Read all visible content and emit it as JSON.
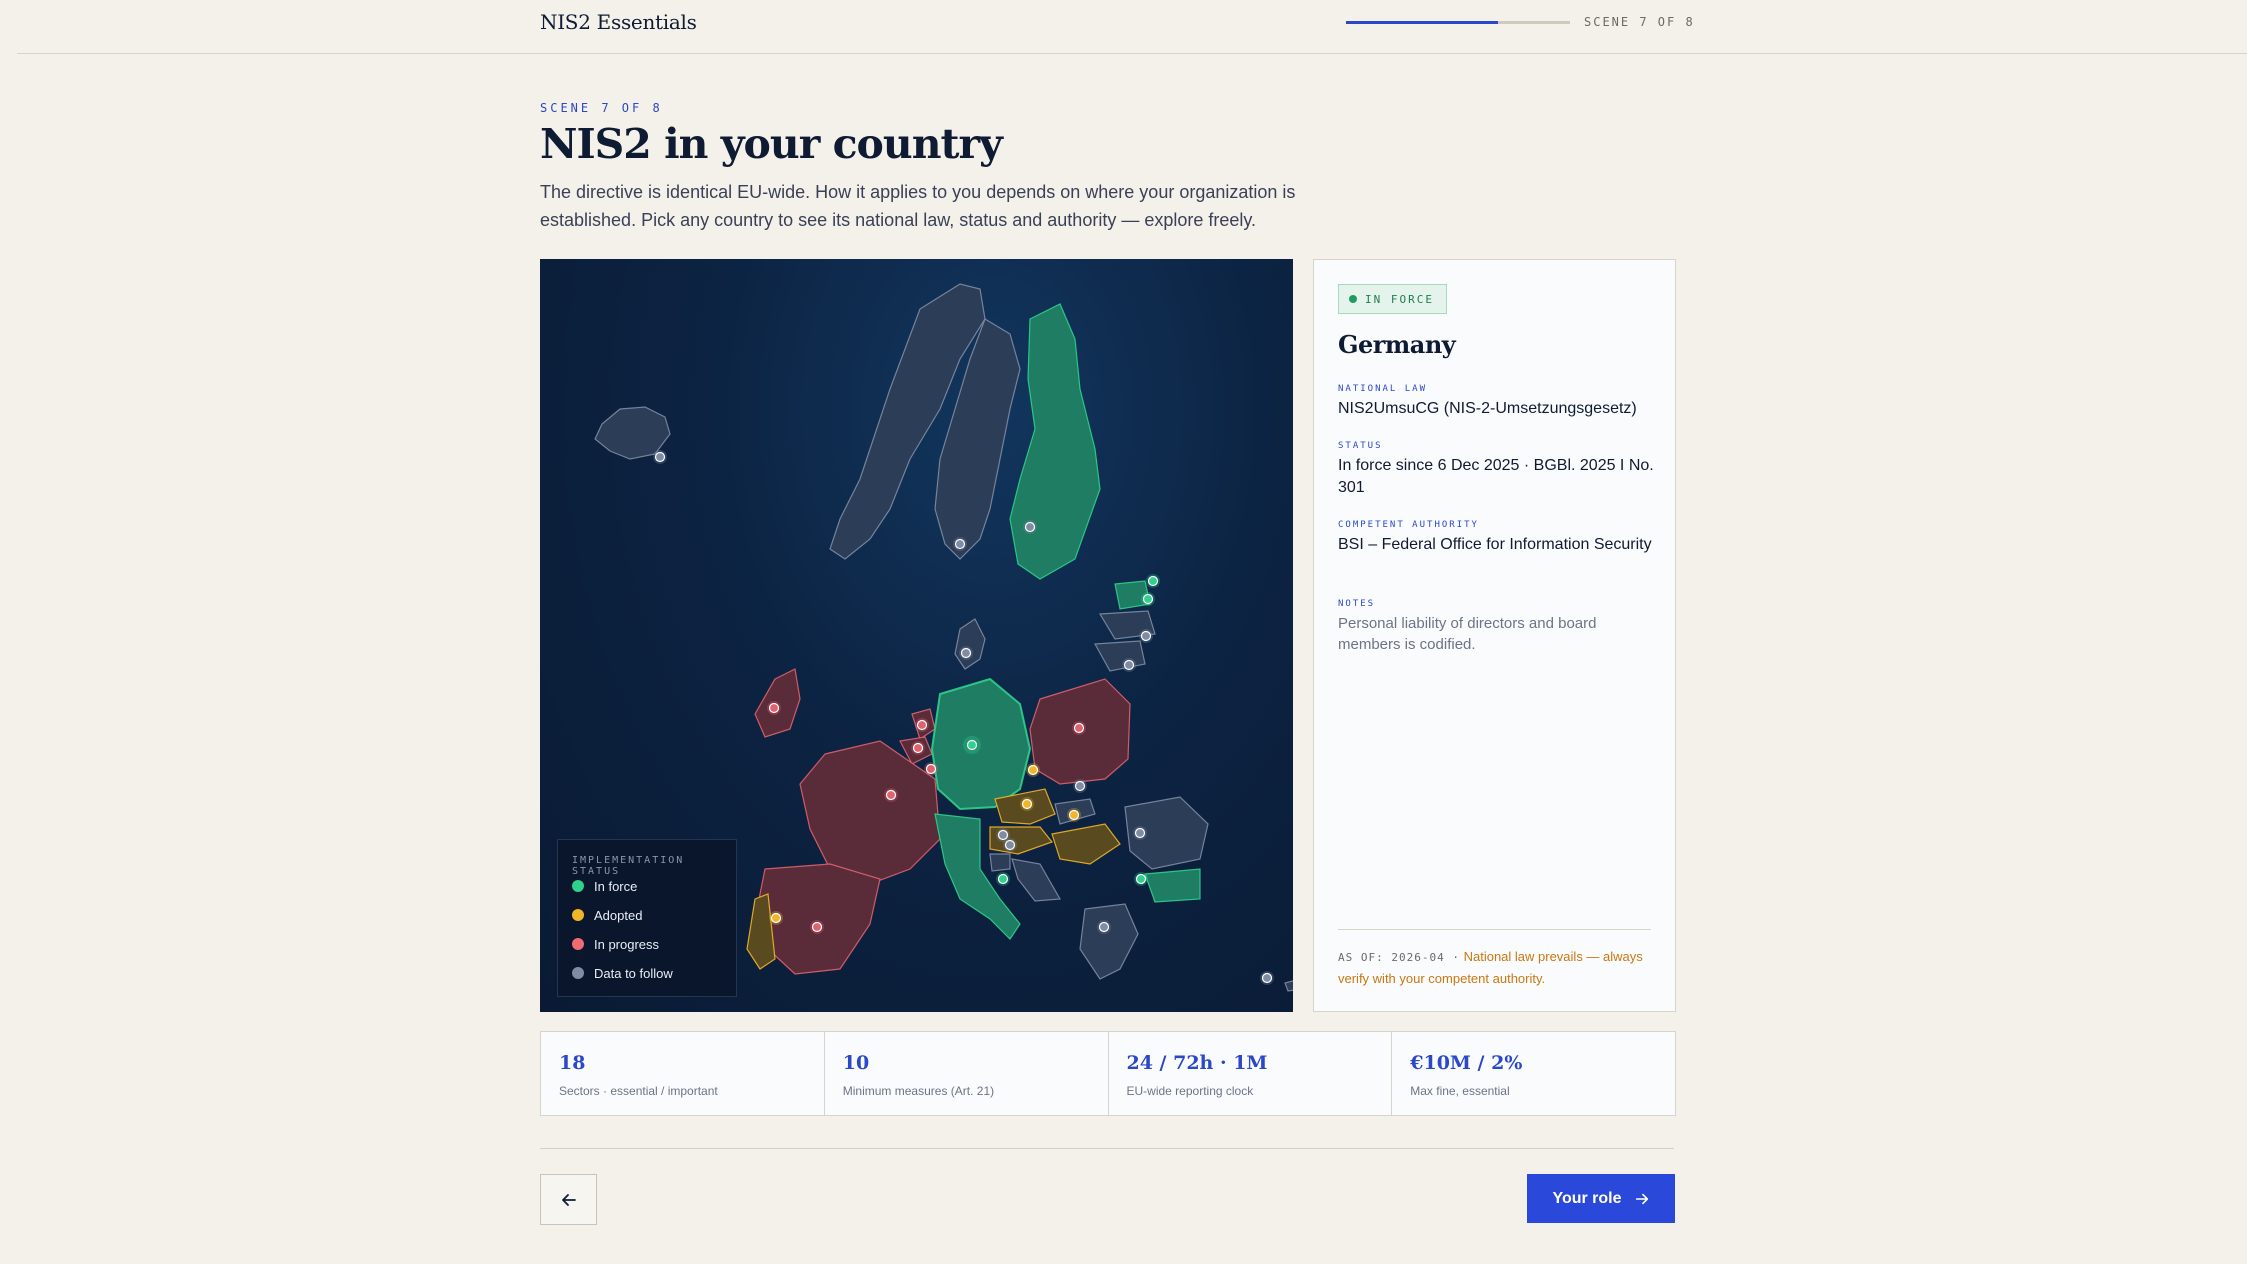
{
  "app": {
    "brand": "NIS2 Essentials",
    "scene_indicator": "SCENE 7 OF 8",
    "progress_fraction": 0.68
  },
  "header": {
    "eyebrow": "SCENE 7 OF 8",
    "title": "NIS2 in your country",
    "lead": "The directive is identical EU-wide. How it applies to you depends on where your organization is established. Pick any country to see its national law, status and authority — explore freely."
  },
  "map": {
    "legend_title": "IMPLEMENTATION STATUS",
    "legend": [
      {
        "label": "In force",
        "color": "#2fd18c"
      },
      {
        "label": "Adopted",
        "color": "#f0b62a"
      },
      {
        "label": "In progress",
        "color": "#f06b73"
      },
      {
        "label": "Data to follow",
        "color": "#7f8ca3"
      }
    ],
    "colors": {
      "in_force_fill": "#1f7d64",
      "in_force_stroke": "#2fd18c",
      "adopted_fill": "#5a4a1f",
      "adopted_stroke": "#f0b62a",
      "progress_fill": "#5a2c3a",
      "progress_stroke": "#e0626e",
      "tbd_fill": "#2c3d58",
      "tbd_stroke": "#7f8ca3"
    },
    "selected_country": "Germany"
  },
  "detail": {
    "status_badge": "IN FORCE",
    "country": "Germany",
    "national_law_label": "NATIONAL LAW",
    "national_law": "NIS2UmsuCG (NIS-2-Umsetzungsgesetz)",
    "status_label": "STATUS",
    "status": "In force since 6 Dec 2025 · BGBl. 2025 I No. 301",
    "authority_label": "COMPETENT AUTHORITY",
    "authority": "BSI – Federal Office for Information Security",
    "notes_label": "NOTES",
    "notes": "Personal liability of directors and board members is codified.",
    "as_of_key": "AS OF: 2026-04 ·",
    "as_of_warning": "National law prevails — always verify with your competent authority."
  },
  "stats": [
    {
      "value": "18",
      "label": "Sectors · essential / important"
    },
    {
      "value": "10",
      "label": "Minimum measures (Art. 21)"
    },
    {
      "value": "24 / 72h · 1M",
      "label": "EU-wide reporting clock"
    },
    {
      "value": "€10M / 2%",
      "label": "Max fine, essential"
    }
  ],
  "nav": {
    "next_label": "Your role"
  }
}
